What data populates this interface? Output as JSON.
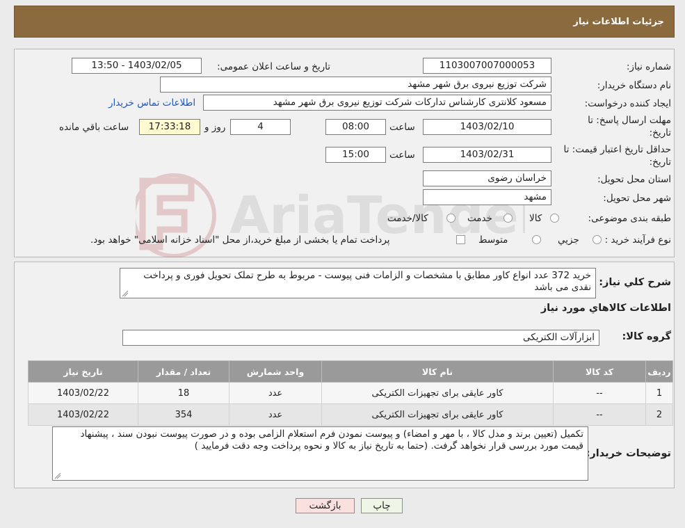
{
  "header": {
    "title": "جزئیات اطلاعات نیاز"
  },
  "form": {
    "need_number_label": "شماره نیاز:",
    "need_number": "1103007007000053",
    "announce_label": "تاریخ و ساعت اعلان عمومی:",
    "announce_value": "1403/02/05 - 13:50",
    "buyer_org_label": "نام دستگاه خریدار:",
    "buyer_org": "شرکت توزیع نیروی برق شهر مشهد",
    "creator_label": "ایجاد کننده درخواست:",
    "creator": "مسعود کلانتری کارشناس تدارکات شرکت توزیع نیروی برق شهر مشهد",
    "contact_link": "اطلاعات تماس خریدار",
    "deadline_label_1": "مهلت ارسال پاسخ: تا",
    "deadline_label_2": "تاریخ:",
    "deadline_date": "1403/02/10",
    "time_label": "ساعت",
    "deadline_time": "08:00",
    "days": "4",
    "days_suffix": "روز و",
    "remaining": "17:33:18",
    "remaining_suffix": "ساعت باقي مانده",
    "validity_label_1": "حداقل تاریخ اعتبار قیمت: تا",
    "validity_label_2": "تاریخ:",
    "validity_date": "1403/02/31",
    "validity_time": "15:00",
    "province_label": "استان محل تحویل:",
    "province": "خراسان رضوی",
    "city_label": "شهر محل تحویل:",
    "city": "مشهد",
    "category_label": "طبقه بندی موضوعی:",
    "category_options": [
      "کالا",
      "خدمت",
      "کالا/خدمت"
    ],
    "process_label": "نوع فرآیند خرید :",
    "process_options": [
      "جزیي",
      "متوسط"
    ],
    "payment_note": "پرداخت تمام یا بخشی از مبلغ خرید،از محل \"اسناد خزانه اسلامی\" خواهد بود."
  },
  "description": {
    "label": "شرح کلي نياز:",
    "text": "خرید 372 عدد انواع کاور  مطابق با مشخصات و الزامات فنی پیوست - مربوط به طرح تملک تحویل فوری و پرداخت نقدی می باشد"
  },
  "goods": {
    "section_title": "اطلاعات کالاهاي مورد نياز",
    "group_label": "گروه کالا:",
    "group_value": "ابزارآلات الکتریکی",
    "columns": [
      "رديف",
      "کد کالا",
      "نام کالا",
      "واحد شمارش",
      "تعداد / مقدار",
      "تاریخ نیاز"
    ],
    "rows": [
      [
        "1",
        "--",
        "کاور عایقی برای تجهیزات الکتریکی",
        "عدد",
        "18",
        "1403/02/22"
      ],
      [
        "2",
        "--",
        "کاور عایقی برای تجهیزات الکتریکی",
        "عدد",
        "354",
        "1403/02/22"
      ]
    ]
  },
  "buyer_notes": {
    "label": "توضیحات خریدار:",
    "text": "تکمیل (تعیین برند و مدل کالا ، با مهر و امضاء) و پیوست نمودن فرم استعلام الزامی بوده و در صورت پیوست نبودن سند ، پیشنهاد قیمت مورد بررسی قرار نخواهد گرفت. (حتما به تاریخ نیاز به کالا و نحوه پرداخت وجه دقت فرمایید )"
  },
  "buttons": {
    "print": "چاپ",
    "back": "بازگشت"
  },
  "watermark": {
    "text": "AriaTender.neT"
  },
  "colors": {
    "header": "#8b6a3e",
    "table_header": "#9a9a9a",
    "link": "#1a55c0",
    "back_button": "#fbe0e0"
  }
}
